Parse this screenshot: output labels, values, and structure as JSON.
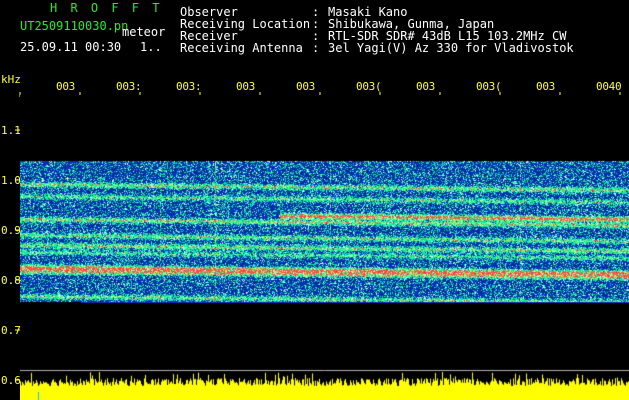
{
  "header": {
    "app_title": "H R O F F T",
    "filename": "UT2509110030.pn",
    "mode": "meteor",
    "datetime": "25.09.11 00:30",
    "page_index": "1..",
    "fields": [
      {
        "label": "Observer",
        "value": "Masaki Kano"
      },
      {
        "label": "Receiving Location",
        "value": "Shibukawa, Gunma, Japan"
      },
      {
        "label": "Receiver",
        "value": "RTL-SDR SDR# 43dB L15 103.2MHz CW"
      },
      {
        "label": "Receiving Antenna",
        "value": "3el Yagi(V) Az 330 for Vladivostok"
      }
    ]
  },
  "axis": {
    "unit": "kHz",
    "y_ticks": [
      "1.1",
      "1.0",
      "0.9",
      "0.8",
      "0.7",
      "0.6"
    ],
    "x_ticks": [
      "003",
      "003:",
      "003:",
      "003",
      "003",
      "003(",
      "003",
      "003(",
      "003",
      "0040"
    ]
  },
  "colors": {
    "background": "#000000",
    "spectrogram_base": "#0a1a8a",
    "signal_green": "#33ff66",
    "signal_red": "#ff3344",
    "header_title": "#22ee22",
    "label_text": "#ffff33",
    "amplitude_bar": "#ffff00"
  }
}
